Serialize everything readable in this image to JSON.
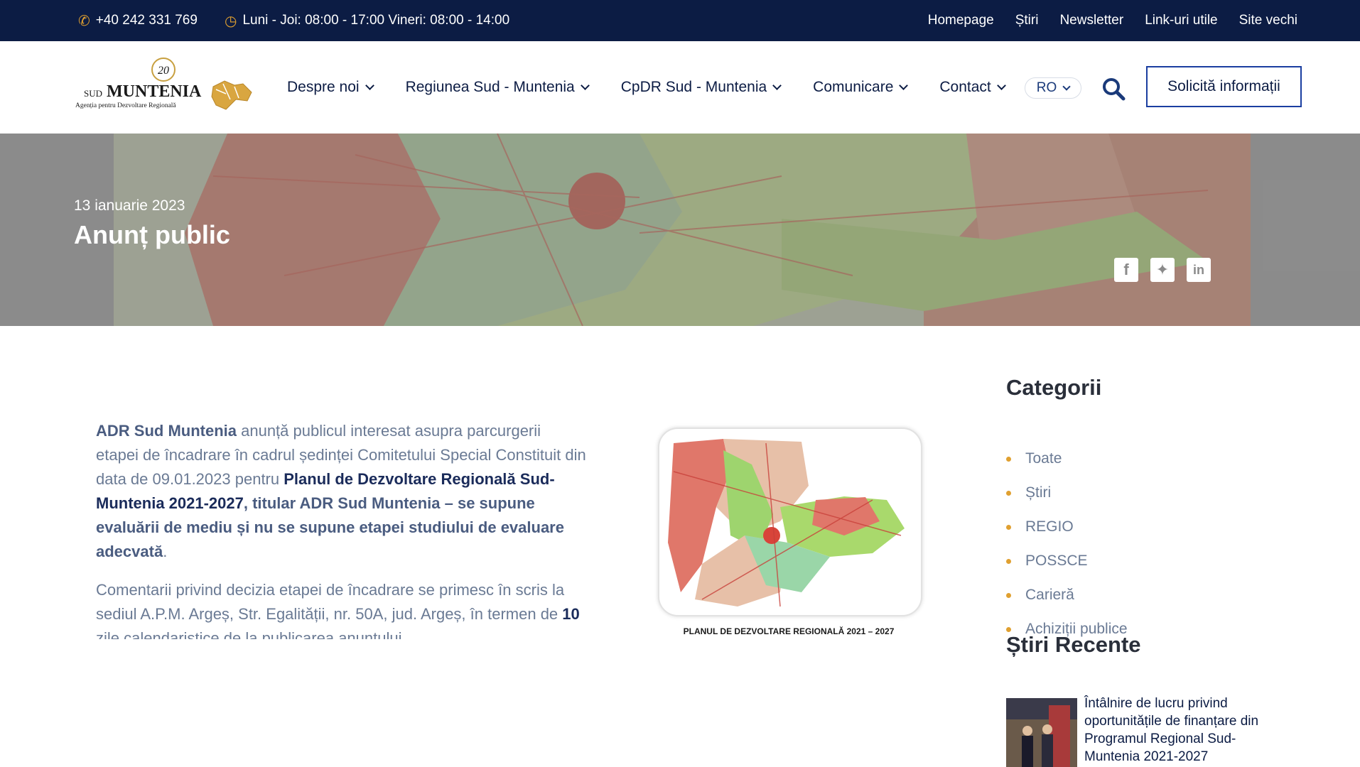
{
  "topbar": {
    "phone": "+40 242 331 769",
    "hours": "Luni - Joi: 08:00 - 17:00 Vineri: 08:00 - 14:00",
    "links": [
      "Homepage",
      "Știri",
      "Newsletter",
      "Link-uri utile",
      "Site vechi"
    ]
  },
  "logo": {
    "badge": "20",
    "prefix": "SUD",
    "name": "MUNTENIA",
    "subtitle": "Agenția pentru Dezvoltare Regională"
  },
  "nav": {
    "items": [
      "Despre noi",
      "Regiunea Sud - Muntenia",
      "CpDR Sud - Muntenia",
      "Comunicare",
      "Contact"
    ],
    "lang": "RO",
    "cta": "Solicită informații"
  },
  "hero": {
    "date": "13 ianuarie 2023",
    "title": "Anunț public",
    "share": [
      "facebook-icon",
      "twitter-icon",
      "linkedin-icon"
    ]
  },
  "article": {
    "p1_a": "ADR Sud Muntenia",
    "p1_b": " anunță publicul interesat asupra parcurgerii etapei de încadrare în cadrul ședinței Comitetului Special Constituit din data de 09.01.2023 pentru ",
    "p1_c": "Planul de Dezvoltare Regională Sud-Muntenia 2021-2027",
    "p1_d": ", titular ADR Sud Muntenia – se supune evaluării de mediu și nu se supune etapei studiului de evaluare adecvată",
    "p1_e": ".",
    "p2_a": "Comentarii privind decizia etapei de încadrare se primesc în scris la sediul A.P.M. Argeș, Str. Egalității, nr. 50A,  jud. Argeș, în termen de ",
    "p2_b": "10",
    "p2_c": " zile calendaristice de la publicarea anunțului",
    "figure_caption": "PLANUL DE DEZVOLTARE REGIONALĂ 2021 – 2027"
  },
  "sidebar": {
    "categories_title": "Categorii",
    "categories": [
      "Toate",
      "Știri",
      "REGIO",
      "POSSCE",
      "Carieră",
      "Achiziții publice"
    ],
    "recent_title": "Știri Recente",
    "recent_item": "Întâlnire de lucru privind oportunitățile de finanțare din Programul Regional Sud-Muntenia 2021-2027"
  }
}
